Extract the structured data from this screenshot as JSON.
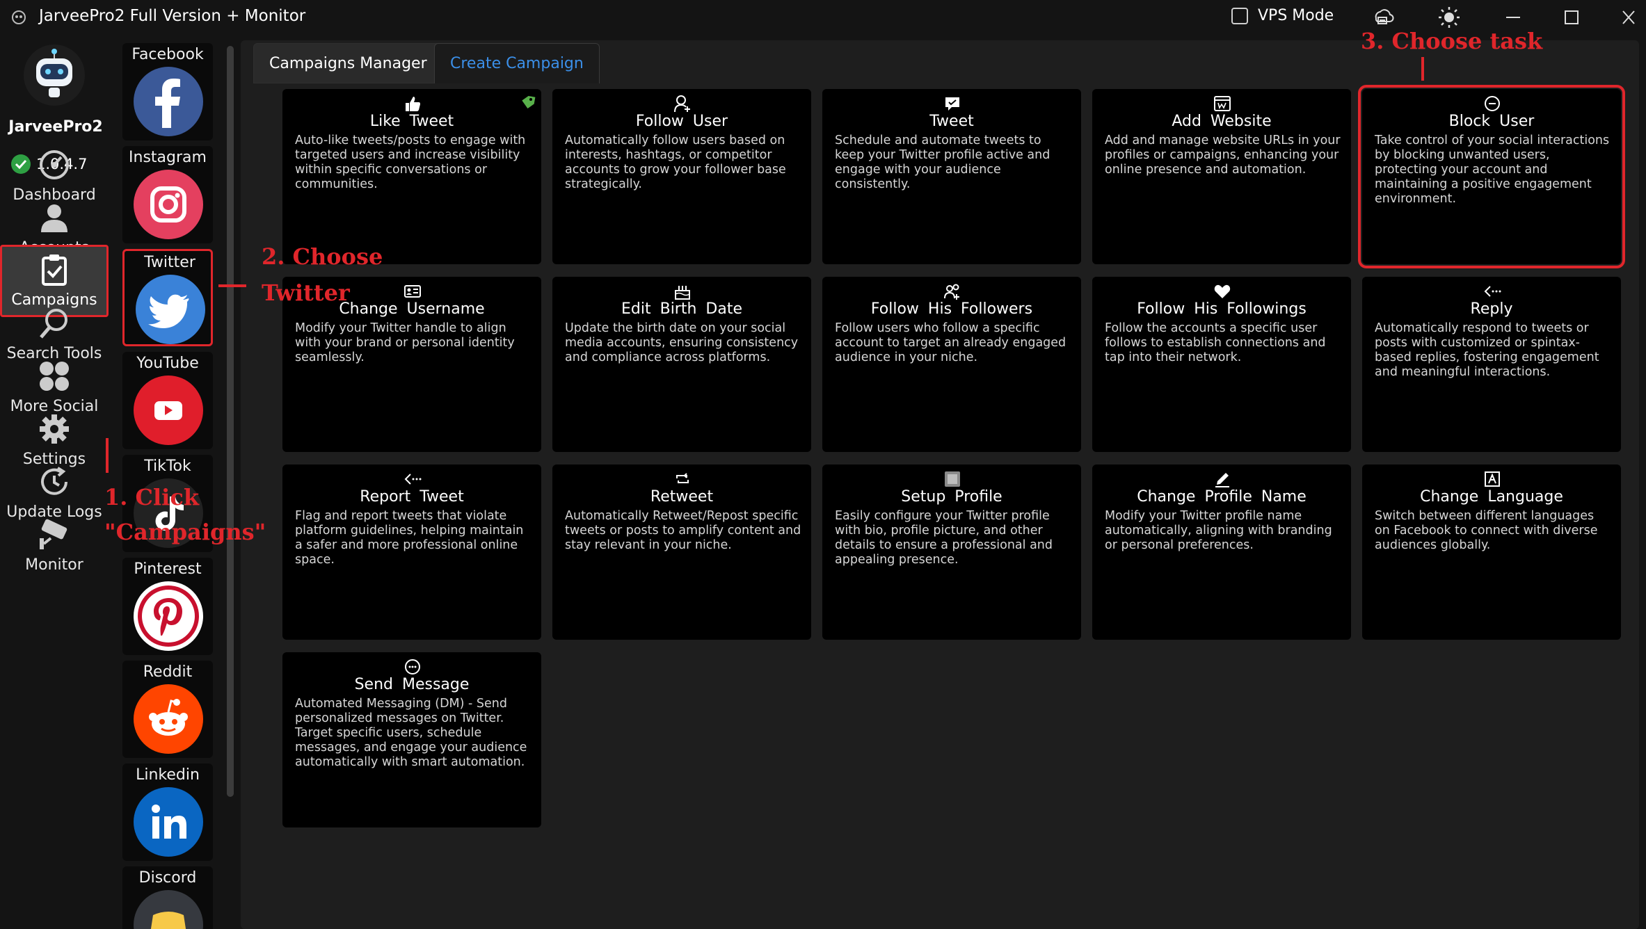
{
  "window": {
    "title": "JarveePro2 Full Version + Monitor",
    "vps_mode_label": "VPS Mode",
    "vps_mode_checked": false
  },
  "sidebar": {
    "brand": "JarveePro2",
    "version": "1.0.4.7",
    "items": [
      {
        "label": "Dashboard",
        "icon": "dashboard-icon"
      },
      {
        "label": "Accounts",
        "icon": "accounts-icon"
      },
      {
        "label": "Campaigns",
        "icon": "campaigns-icon",
        "active": true
      },
      {
        "label": "Search Tools",
        "icon": "search-icon"
      },
      {
        "label": "More Social",
        "icon": "more-social-icon"
      },
      {
        "label": "Settings",
        "icon": "gear-icon"
      },
      {
        "label": "Update Logs",
        "icon": "update-logs-icon"
      },
      {
        "label": "Monitor",
        "icon": "monitor-camera-icon"
      }
    ]
  },
  "social": {
    "items": [
      {
        "name": "Facebook",
        "color": "#3b5998"
      },
      {
        "name": "Instagram",
        "color": "#e4405f"
      },
      {
        "name": "Twitter",
        "color": "#3a82d8",
        "selected": true
      },
      {
        "name": "YouTube",
        "color": "#e01e2b"
      },
      {
        "name": "TikTok",
        "color": "#222222"
      },
      {
        "name": "Pinterest",
        "color": "#c8102e"
      },
      {
        "name": "Reddit",
        "color": "#ff4500"
      },
      {
        "name": "Linkedin",
        "color": "#0a66c2"
      },
      {
        "name": "Discord",
        "color": "#5865f2"
      }
    ]
  },
  "tabs": {
    "items": [
      {
        "label": "Campaigns Manager",
        "active": false
      },
      {
        "label": "Create Campaign",
        "active": true
      }
    ]
  },
  "cards": [
    {
      "title": "Like Tweet",
      "icon": "thumbs-up-icon",
      "desc": "Auto-like tweets/posts to engage with targeted users and increase visibility within specific conversations or communities."
    },
    {
      "title": "Follow User",
      "icon": "add-user-icon",
      "desc": "Automatically follow users based on interests, hashtags, or competitor accounts to grow your follower base strategically."
    },
    {
      "title": "Tweet",
      "icon": "tweet-bubble-icon",
      "desc": "Schedule and automate tweets to keep your Twitter profile active and engage with your audience consistently."
    },
    {
      "title": "Add Website",
      "icon": "website-icon",
      "desc": "Add and manage website URLs in your profiles or campaigns, enhancing your online presence and automation."
    },
    {
      "title": "Block User",
      "icon": "block-icon",
      "desc": "Take control of your social interactions by blocking unwanted users, protecting your account and maintaining a positive engagement environment."
    },
    {
      "title": "Change Username",
      "icon": "id-card-icon",
      "desc": "Modify your Twitter handle to align with your brand or personal identity seamlessly."
    },
    {
      "title": "Edit Birth Date",
      "icon": "birthday-cake-icon",
      "desc": "Update the birth date on your social media accounts, ensuring consistency and compliance across platforms."
    },
    {
      "title": "Follow His Followers",
      "icon": "followers-icon",
      "desc": "Follow users who follow a specific account to target an already engaged audience in your niche."
    },
    {
      "title": "Follow His Followings",
      "icon": "heart-user-icon",
      "desc": "Follow the accounts a specific user follows to establish connections and tap into their network."
    },
    {
      "title": "Reply",
      "icon": "reply-icon",
      "desc": "Automatically respond to tweets or posts with customized or spintax-based replies, fostering engagement and meaningful interactions."
    },
    {
      "title": "Report Tweet",
      "icon": "report-icon",
      "desc": "Flag and report tweets that violate platform guidelines, helping maintain a safer and more professional online space."
    },
    {
      "title": "Retweet",
      "icon": "retweet-icon",
      "desc": "Automatically Retweet/Repost specific tweets or posts to amplify content and stay relevant in your niche."
    },
    {
      "title": "Setup Profile",
      "icon": "profile-setup-icon",
      "desc": "Easily configure your Twitter profile with bio, profile picture, and other details to ensure a professional and appealing presence."
    },
    {
      "title": "Change Profile Name",
      "icon": "pencil-icon",
      "desc": "Modify your Twitter profile name automatically, aligning with branding or personal preferences."
    },
    {
      "title": "Change Language",
      "icon": "language-icon",
      "desc": "Switch between different languages on Facebook to connect with diverse audiences globally."
    },
    {
      "title": "Send Message",
      "icon": "message-icon",
      "desc": "Automated Messaging (DM) - Send personalized messages on Twitter. Target specific users, schedule messages, and engage your audience automatically with smart automation."
    }
  ],
  "annotations": {
    "step1_line1": "1. Click",
    "step1_line2": "\"Campaigns\"",
    "step2_line1": "2. Choose",
    "step2_line2": "Twitter",
    "step3": "3. Choose task"
  },
  "colors": {
    "accent_blue": "#3b8fe8",
    "annotation_red": "#e0262b",
    "success_green": "#2ea043"
  }
}
